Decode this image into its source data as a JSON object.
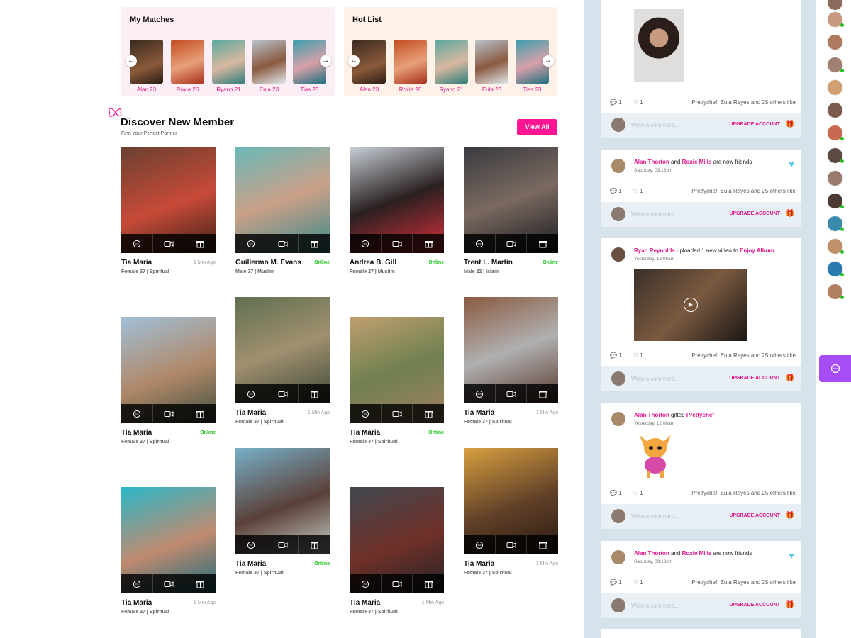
{
  "my_matches": {
    "title": "My Matches",
    "items": [
      {
        "name": "Alan 23"
      },
      {
        "name": "Roxie 26"
      },
      {
        "name": "Ryann 21"
      },
      {
        "name": "Eula 23"
      },
      {
        "name": "Tias 23"
      }
    ]
  },
  "hot_list": {
    "title": "Hot List",
    "items": [
      {
        "name": "Alan 23"
      },
      {
        "name": "Roxie 26"
      },
      {
        "name": "Ryann 21"
      },
      {
        "name": "Eula 23"
      },
      {
        "name": "Tias 23"
      }
    ]
  },
  "discover": {
    "title": "Discover New Member",
    "subtitle": "Find Your Perfect Partner",
    "view_all": "View All"
  },
  "members": [
    {
      "name": "Tia Maria",
      "status": "1 Min Ago",
      "meta": "Female 37  |  Spiritual"
    },
    {
      "name": "Guillermo M. Evans",
      "status": "Online",
      "meta": "Male 37  |  Muslim"
    },
    {
      "name": "Andrea B. Gill",
      "status": "Online",
      "meta": "Female 27  |  Muslim"
    },
    {
      "name": "Trent L. Martin",
      "status": "Online",
      "meta": "Male 22  |  Islam"
    },
    {
      "name": "Tia Maria",
      "status": "Online",
      "meta": "Female 37  |  Spiritual"
    },
    {
      "name": "Tia Maria",
      "status": "1 Min Ago",
      "meta": "Female 37  |  Spiritual"
    },
    {
      "name": "Tia Maria",
      "status": "Online",
      "meta": "Female 37  |  Spiritual"
    },
    {
      "name": "Tia Maria",
      "status": "1 Min Ago",
      "meta": "Female 37  |  Spiritual"
    },
    {
      "name": "Tia Maria",
      "status": "1 Min Ago",
      "meta": "Female 37  |  Spiritual"
    },
    {
      "name": "Tia Maria",
      "status": "Online",
      "meta": "Female 37  |  Spiritual"
    },
    {
      "name": "Tia Maria",
      "status": "1 Min Ago",
      "meta": "Female 37  |  Spiritual"
    },
    {
      "name": "Tia Maria",
      "status": "1 Min Ago",
      "meta": "Female 37  |  Spiritual"
    }
  ],
  "feed": {
    "comment_placeholder": "Write a comment...",
    "upgrade": "UPGRADE ACCOUNT",
    "comments_count": "1",
    "likes_count": "1",
    "likes_text": "Prettychef, Eula Reyes and 25 others like",
    "posts": [
      {
        "actor": "",
        "verb": "",
        "target": "",
        "time": ""
      },
      {
        "actor": "Alan Thorton",
        "verb": "and",
        "target": "Roxie Mills",
        "tail": "are now friends",
        "time": "Saturday, 09:13pm"
      },
      {
        "actor": "Ryan Reynolds",
        "verb": "uploaded 1 new video to",
        "target": "Enjoy Album",
        "tail": "",
        "time": "Yesterday, 12:08am"
      },
      {
        "actor": "Alan Thorton",
        "verb": "gifted",
        "target": "Prettychef",
        "tail": "",
        "time": "Yesterday, 12:08am"
      },
      {
        "actor": "Alan Thorton",
        "verb": "and",
        "target": "Roxie Mills",
        "tail": "are now friends",
        "time": "Saturday, 09:13pm"
      }
    ]
  },
  "colors": {
    "accent": "#ff1493",
    "online": "#21c11f",
    "chat": "#a64df5",
    "feed_bg": "#d6e3ea"
  }
}
